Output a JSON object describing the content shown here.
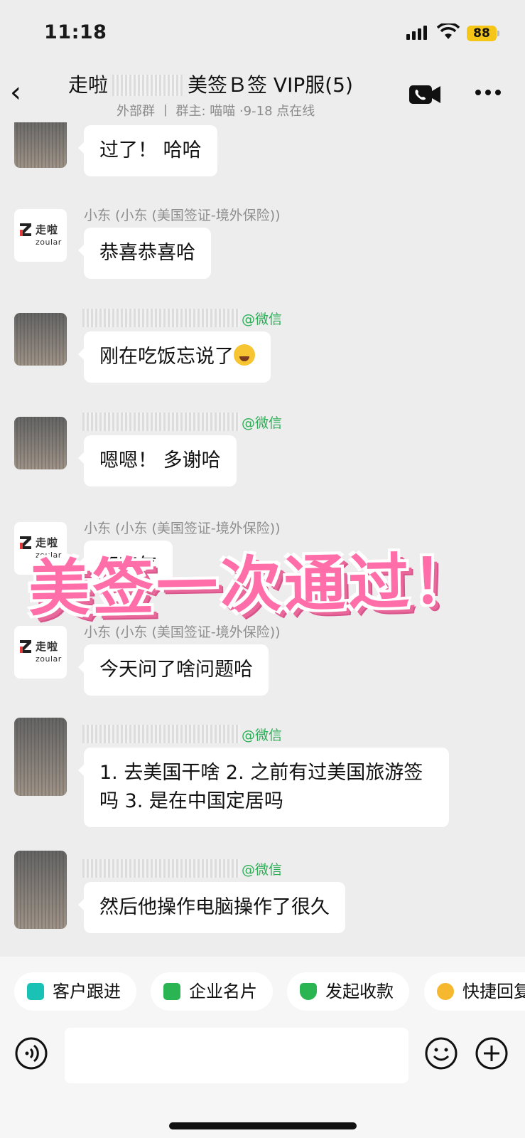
{
  "status_bar": {
    "time": "11:18",
    "battery": "88"
  },
  "header": {
    "title_prefix": "走啦",
    "title_suffix": "美签Ｂ签 VIP服(5)",
    "subtitle": "外部群 丨 群主: 喵喵 ·9-18 点在线"
  },
  "messages": [
    {
      "sender": "",
      "text": "过了！ 哈哈"
    },
    {
      "sender": "小东 (小东 (美国签证-境外保险))",
      "text": "恭喜恭喜哈"
    },
    {
      "sender_tag": "@微信",
      "text": "刚在吃饭忘说了"
    },
    {
      "sender_tag": "@微信",
      "text": "嗯嗯！ 多谢哈"
    },
    {
      "sender": "小东 (小东 (美国签证-境外保险))",
      "text": "不客气"
    },
    {
      "sender": "小东 (小东 (美国签证-境外保险))",
      "text": "今天问了啥问题哈"
    },
    {
      "sender_tag": "@微信",
      "text": "1. 去美国干啥 2. 之前有过美国旅游签吗 3. 是在中国定居吗"
    },
    {
      "sender_tag": "@微信",
      "text": "然后他操作电脑操作了很久"
    }
  ],
  "logo": {
    "cn": "走啦",
    "en": "zoular"
  },
  "overlay": "美签一次通过！",
  "quick_actions": [
    {
      "label": "客户跟进",
      "color": "#19c2b4"
    },
    {
      "label": "企业名片",
      "color": "#2bb552"
    },
    {
      "label": "发起收款",
      "color": "#2bb552"
    },
    {
      "label": "快捷回复",
      "color": "#f5b82e"
    }
  ],
  "input": {
    "placeholder": ""
  }
}
